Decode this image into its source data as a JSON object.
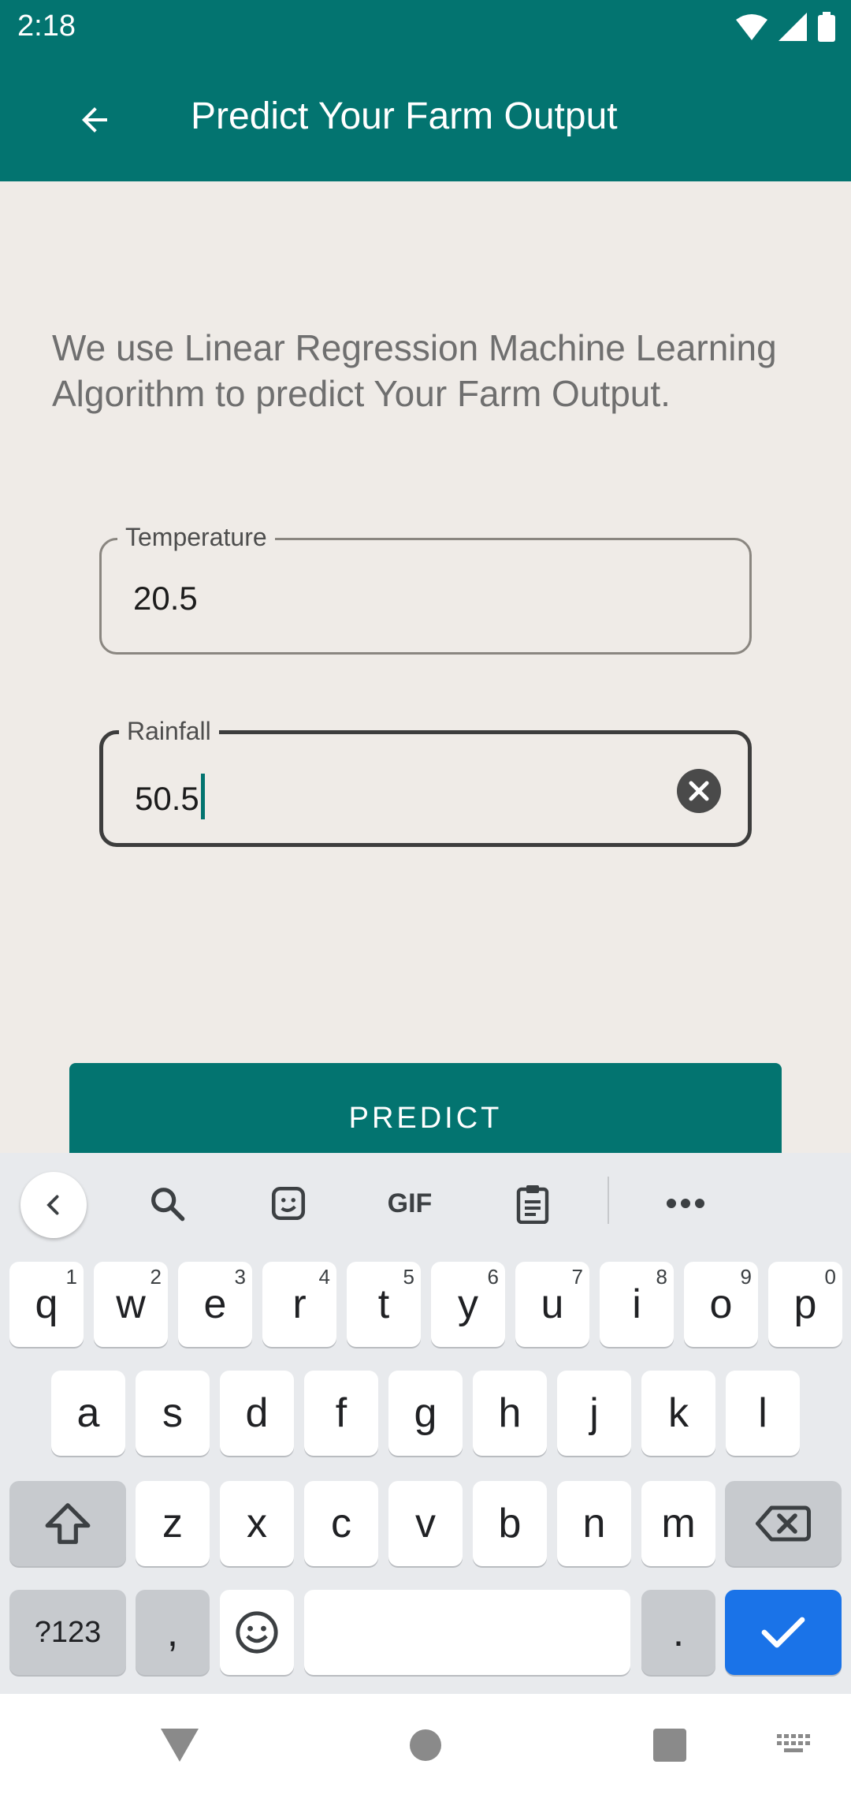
{
  "status_bar": {
    "time": "2:18"
  },
  "app_bar": {
    "title": "Predict Your Farm Output"
  },
  "description": "We use Linear Regression Machine Learning Algorithm to predict Your Farm Output.",
  "fields": [
    {
      "label": "Temperature",
      "value": "20.5"
    },
    {
      "label": "Rainfall",
      "value": "50.5"
    }
  ],
  "predict_button": "PREDICT",
  "keyboard": {
    "toolbar": [
      "collapse-icon",
      "search-icon",
      "sticker-icon",
      "GIF",
      "clipboard-icon",
      "more-icon"
    ],
    "gif_label": "GIF",
    "row1": [
      {
        "key": "q",
        "hint": "1"
      },
      {
        "key": "w",
        "hint": "2"
      },
      {
        "key": "e",
        "hint": "3"
      },
      {
        "key": "r",
        "hint": "4"
      },
      {
        "key": "t",
        "hint": "5"
      },
      {
        "key": "y",
        "hint": "6"
      },
      {
        "key": "u",
        "hint": "7"
      },
      {
        "key": "i",
        "hint": "8"
      },
      {
        "key": "o",
        "hint": "9"
      },
      {
        "key": "p",
        "hint": "0"
      }
    ],
    "row2": [
      "a",
      "s",
      "d",
      "f",
      "g",
      "h",
      "j",
      "k",
      "l"
    ],
    "row3": [
      "z",
      "x",
      "c",
      "v",
      "b",
      "n",
      "m"
    ],
    "symbols_key": "?123",
    "comma_key": ",",
    "period_key": "."
  },
  "colors": {
    "primary": "#037470",
    "background": "#efebe7",
    "accent_blue": "#1a73e8"
  }
}
